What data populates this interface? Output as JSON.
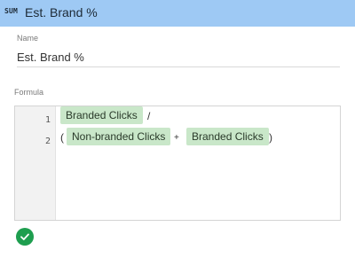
{
  "header": {
    "badge": "SUM",
    "title": "Est. Brand %"
  },
  "name_field": {
    "label": "Name",
    "value": "Est. Brand %"
  },
  "formula": {
    "label": "Formula",
    "line_numbers": [
      "1",
      "2"
    ],
    "line1": {
      "token1": "Branded Clicks",
      "operator": "/"
    },
    "line2": {
      "open_paren": "(",
      "token1": "Non-branded Clicks",
      "operator": "+",
      "token2": "Branded Clicks",
      "close_paren": ")"
    }
  },
  "status": {
    "icon": "check-circle-icon",
    "color": "#1e9e4f"
  },
  "colors": {
    "header_bg": "#9ec9f4",
    "token_bg": "#c9e7c9"
  }
}
